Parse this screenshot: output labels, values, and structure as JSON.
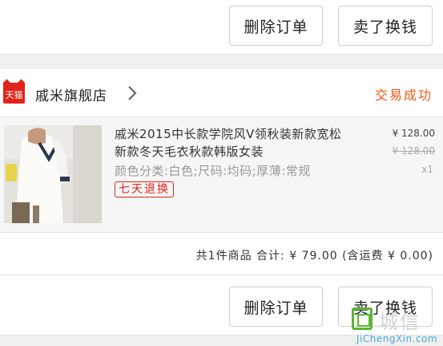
{
  "top_actions": {
    "delete_label": "删除订单",
    "sell_label": "卖了换钱"
  },
  "store": {
    "logo_text": "天猫",
    "name": "戚米旗舰店",
    "status": "交易成功",
    "logo_color": "#e2231a",
    "status_color": "#f05a14"
  },
  "item": {
    "title": "戚米2015中长款学院风V领秋装新款宽松新款冬天毛衣秋款韩版女装",
    "sku": "颜色分类:白色;尺码:均码;厚薄:常规",
    "badge": "七天退换",
    "price": "¥ 128.00",
    "original_price": "¥ 128.00",
    "quantity": "x1"
  },
  "summary": {
    "text": "共1件商品  合计: ¥ 79.00 (含运费 ¥ 0.00)"
  },
  "bottom_actions": {
    "delete_label": "删除订单",
    "sell_label": "卖了换钱"
  },
  "watermark": {
    "text_cn": "城信",
    "text_en": "JiChengXin.com"
  }
}
